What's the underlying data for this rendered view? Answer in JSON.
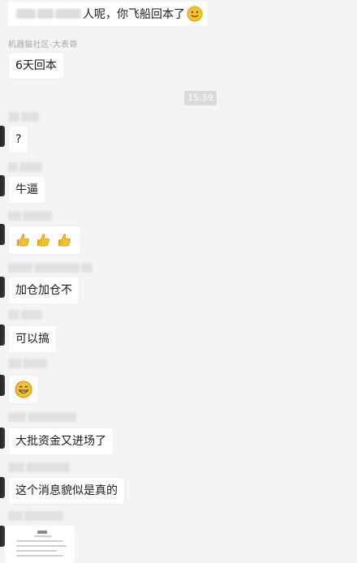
{
  "messages": {
    "m1": {
      "text": "人呢，你飞船回本了"
    },
    "m1_sender": "机器猫社区-大表哥",
    "m2": {
      "text": "6天回本"
    },
    "timestamp": "15:59",
    "m3": {
      "text": "?"
    },
    "m4": {
      "text": "牛逼"
    },
    "m5": {
      "emoji_icons": [
        "thumbs-up-icon",
        "thumbs-up-icon",
        "thumbs-up-icon"
      ]
    },
    "m6": {
      "text": "加仓加仓不"
    },
    "m7": {
      "text": "可以搞"
    },
    "m8": {
      "emoji_icons": [
        "grin-face-icon"
      ]
    },
    "m9": {
      "text": "大批资金又进场了"
    },
    "m10": {
      "text": "这个消息貌似是真的"
    }
  },
  "colors": {
    "chat_bg": "#f4f4f5",
    "bubble_bg": "#ffffff",
    "time_badge_bg": "#dadada",
    "emoji_yellow": "#f3c22b"
  }
}
